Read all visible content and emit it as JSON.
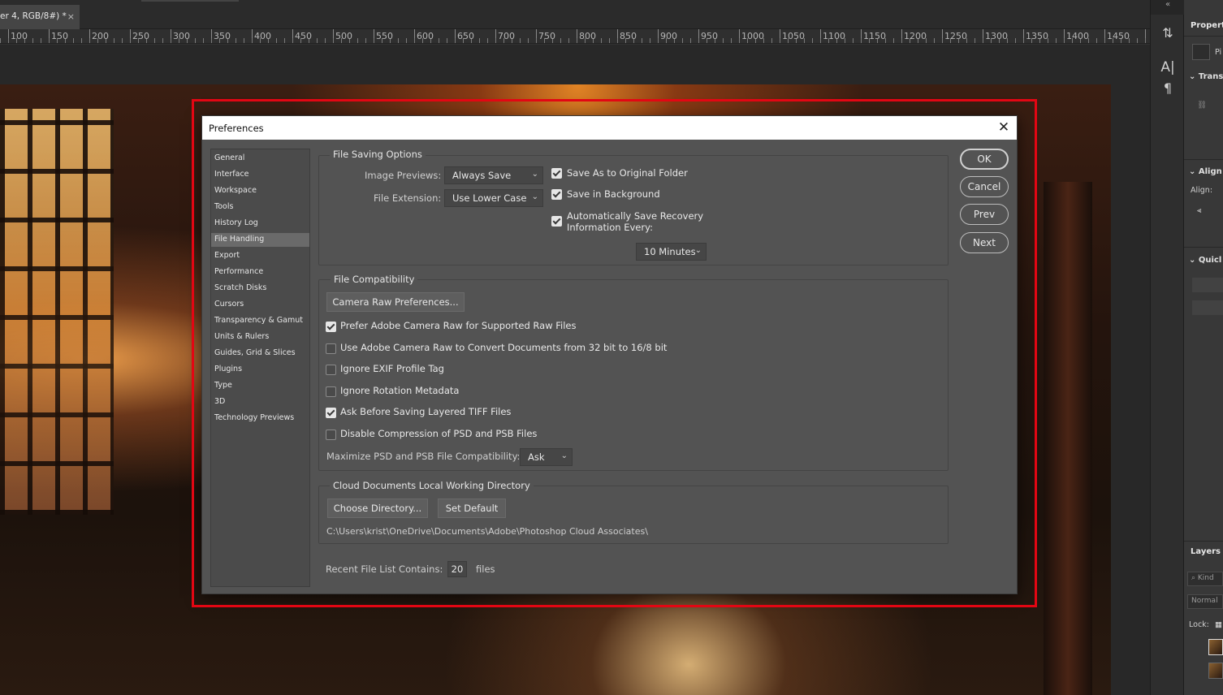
{
  "document_tab": {
    "title": "er 4, RGB/8#) *",
    "close": "×"
  },
  "ruler": {
    "labels": [
      "100",
      "150",
      "200",
      "250",
      "300",
      "350",
      "400",
      "450",
      "500",
      "550",
      "600",
      "650",
      "700",
      "750",
      "800",
      "850",
      "900",
      "950",
      "1000",
      "1050",
      "1100",
      "1150",
      "1200",
      "1250",
      "1300",
      "1350",
      "1400",
      "1450"
    ]
  },
  "right_panel": {
    "properties_title": "Properti",
    "properties_tab": "Pi",
    "transform": "Trans",
    "align_section": "Align",
    "align_label": "Align:",
    "quick_section": "Quicl",
    "layers_tab": "Layers",
    "kind_search": "Kind",
    "blend_mode": "Normal",
    "lock_label": "Lock:"
  },
  "dialog": {
    "title": "Preferences",
    "nav_items": [
      "General",
      "Interface",
      "Workspace",
      "Tools",
      "History Log",
      "File Handling",
      "Export",
      "Performance",
      "Scratch Disks",
      "Cursors",
      "Transparency & Gamut",
      "Units & Rulers",
      "Guides, Grid & Slices",
      "Plugins",
      "Type",
      "3D",
      "Technology Previews"
    ],
    "nav_selected": "File Handling",
    "buttons": {
      "ok": "OK",
      "cancel": "Cancel",
      "prev": "Prev",
      "next": "Next"
    },
    "file_saving": {
      "title": "File Saving Options",
      "image_previews_label": "Image Previews:",
      "image_previews_value": "Always Save",
      "file_extension_label": "File Extension:",
      "file_extension_value": "Use Lower Case",
      "save_as_original": "Save As to Original Folder",
      "save_in_background": "Save in Background",
      "auto_save_line1": "Automatically Save Recovery",
      "auto_save_line2": "Information Every:",
      "auto_save_interval": "10 Minutes"
    },
    "file_compat": {
      "title": "File Compatibility",
      "camera_raw_button": "Camera Raw Preferences...",
      "prefer_acr": "Prefer Adobe Camera Raw for Supported Raw Files",
      "use_acr_convert": "Use Adobe Camera Raw to Convert Documents from 32 bit to 16/8 bit",
      "ignore_exif": "Ignore EXIF Profile Tag",
      "ignore_rotation": "Ignore Rotation Metadata",
      "ask_tiff": "Ask Before Saving Layered TIFF Files",
      "disable_compression": "Disable Compression of PSD and PSB Files",
      "maximize_label": "Maximize PSD and PSB File Compatibility:",
      "maximize_value": "Ask"
    },
    "cloud": {
      "title": "Cloud Documents Local Working Directory",
      "choose_button": "Choose Directory...",
      "default_button": "Set Default",
      "path": "C:\\Users\\krist\\OneDrive\\Documents\\Adobe\\Photoshop Cloud Associates\\"
    },
    "recent": {
      "label": "Recent File List Contains:",
      "value": "20",
      "suffix": "files"
    }
  },
  "highlight_color": "#e30613"
}
